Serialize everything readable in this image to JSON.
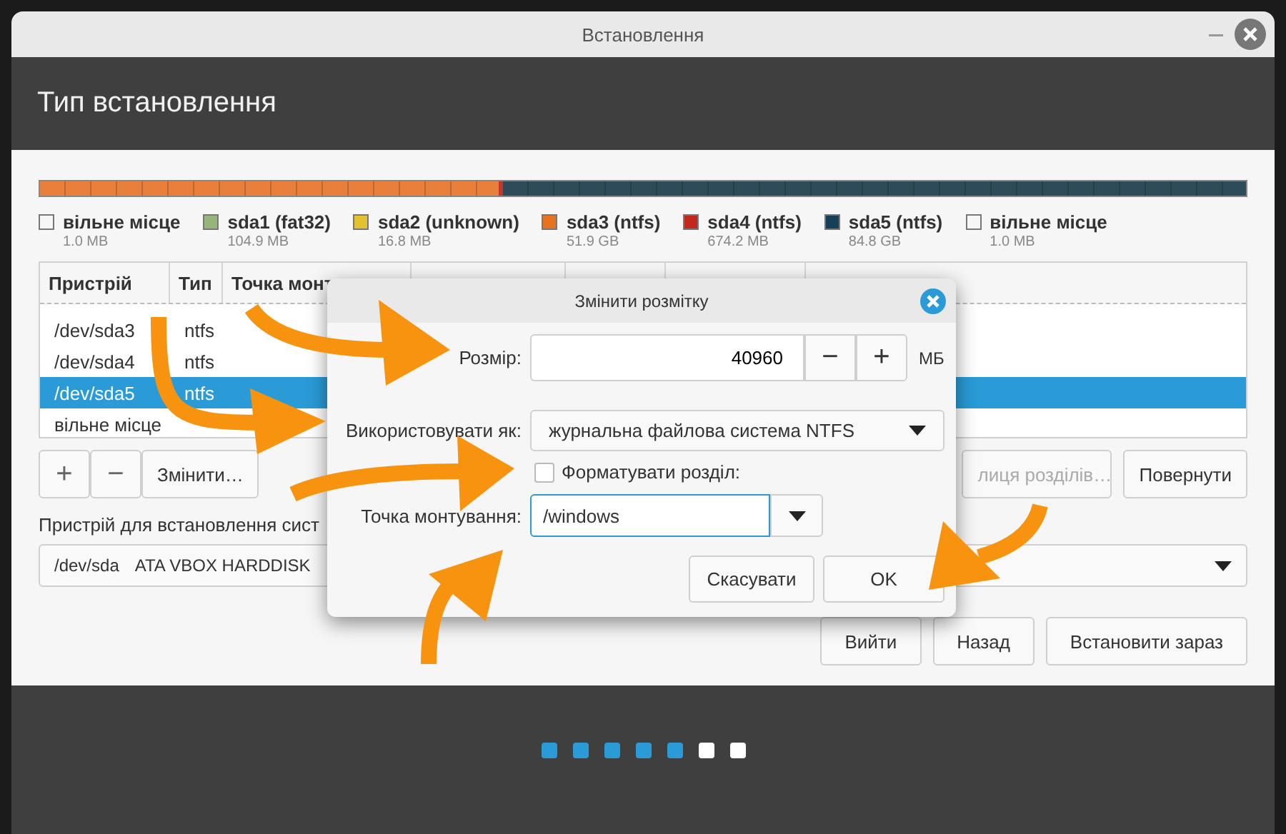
{
  "window": {
    "title": "Встановлення",
    "heading": "Тип встановлення"
  },
  "partition_bar": {
    "segments": [
      {
        "color": "#e8803c",
        "level": 0.38
      },
      {
        "color": "#c5372b",
        "level": 0.004
      },
      {
        "color": "#2e4b5a",
        "level": 0.616
      }
    ]
  },
  "legend": [
    {
      "label": "вільне місце",
      "size": "1.0 MB",
      "color": "#f6f6f6"
    },
    {
      "label": "sda1 (fat32)",
      "size": "104.9 MB",
      "color": "#95b57a"
    },
    {
      "label": "sda2 (unknown)",
      "size": "16.8 MB",
      "color": "#e4c12e"
    },
    {
      "label": "sda3 (ntfs)",
      "size": "51.9 GB",
      "color": "#e8731f"
    },
    {
      "label": "sda4 (ntfs)",
      "size": "674.2 MB",
      "color": "#c4281c"
    },
    {
      "label": "sda5 (ntfs)",
      "size": "84.8 GB",
      "color": "#163f58"
    },
    {
      "label": "вільне місце",
      "size": "1.0 MB",
      "color": "#f6f6f6"
    }
  ],
  "table": {
    "columns": [
      "Пристрій",
      "Тип",
      "Точка монт"
    ],
    "rows": [
      {
        "device": "/dev/sda3",
        "type": "ntfs",
        "selected": false
      },
      {
        "device": "/dev/sda4",
        "type": "ntfs",
        "selected": false
      },
      {
        "device": "/dev/sda5",
        "type": "ntfs",
        "selected": true
      },
      {
        "device": "вільне місце",
        "type": "",
        "selected": false
      }
    ]
  },
  "table_buttons": [
    {
      "label": "+",
      "kind": "icon"
    },
    {
      "label": "−",
      "kind": "icon"
    },
    {
      "label": "Змінити…",
      "kind": "text"
    }
  ],
  "right_buttons": [
    {
      "label": "лиця розділів…",
      "disabled": true
    },
    {
      "label": "Повернути",
      "disabled": false
    }
  ],
  "device_label": "Пристрій для встановлення сист",
  "device_combo": {
    "device": "/dev/sda",
    "model": "ATA VBOX HARDDISK"
  },
  "nav_buttons": [
    "Вийти",
    "Назад",
    "Встановити зараз"
  ],
  "steps": [
    {
      "done": true
    },
    {
      "done": true
    },
    {
      "done": true
    },
    {
      "done": true
    },
    {
      "done": true
    },
    {
      "done": false
    },
    {
      "done": false
    }
  ],
  "dialog": {
    "title": "Змінити розмітку",
    "size": {
      "label": "Розмір:",
      "value": "40960",
      "minus": "−",
      "plus": "+",
      "unit": "МБ"
    },
    "use_as": {
      "label": "Використовувати як:",
      "value": "журнальна файлова система NTFS"
    },
    "format": {
      "label": "Форматувати розділ:",
      "checked": false
    },
    "mount": {
      "label": "Точка монтування:",
      "value": "/windows"
    },
    "buttons": [
      "Скасувати",
      "OK"
    ]
  }
}
